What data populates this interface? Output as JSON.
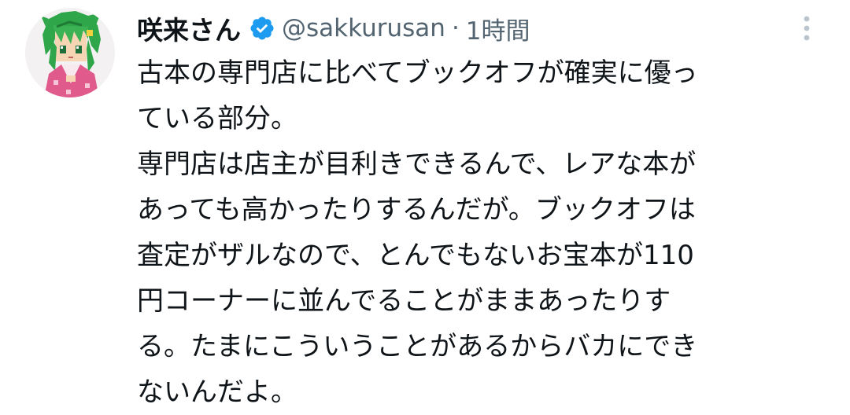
{
  "tweet": {
    "author": {
      "display_name": "咲来さん",
      "handle": "@sakkurusan",
      "verified": true,
      "avatar_icon": "anime-girl-pixel-avatar"
    },
    "separator": "·",
    "time": "1時間",
    "text_lines": [
      "古本の専門店に比べてブックオフが確実に優っ",
      "ている部分。",
      "専門店は店主が目利きできるんで、レアな本が",
      "あっても高かったりするんだが。ブックオフは",
      "査定がザルなので、とんでもないお宝本が110",
      "円コーナーに並んでることがままあったりす",
      "る。たまにこういうことがあるからバカにでき",
      "ないんだよ。"
    ],
    "more_icon": "more-vertical-icon"
  },
  "colors": {
    "text": "#0f1419",
    "secondary": "#536471",
    "verified_badge": "#1d9bf0"
  }
}
